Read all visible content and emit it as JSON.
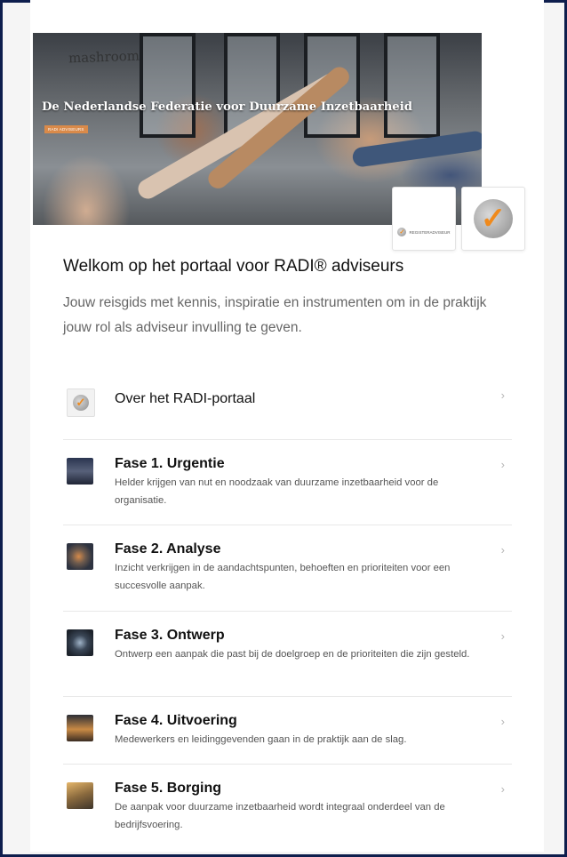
{
  "hero": {
    "title": "De Nederlandse Federatie voor Duurzame Inzetbaarheid",
    "tag": "RADI ADVISEURS",
    "brand": "mashroom"
  },
  "logos": {
    "register_label": "REGISTERADVISEUR"
  },
  "welcome": {
    "title": "Welkom op het portaal voor RADI® adviseurs",
    "intro": "Jouw reisgids met kennis, inspiratie en instrumenten om in de praktijk jouw rol als adviseur invulling te geven."
  },
  "items": [
    {
      "title": "Over het RADI-portaal",
      "desc": "",
      "icon": "radi-check-icon"
    },
    {
      "title": "Fase 1. Urgentie",
      "desc": "Helder krijgen van nut en noodzaak van duurzame inzetbaarheid voor de organisatie.",
      "icon": "urgency-thumbnail"
    },
    {
      "title": "Fase 2. Analyse",
      "desc": "Inzicht verkrijgen in de aandachtspunten, behoeften en prioriteiten voor een succesvolle aanpak.",
      "icon": "analysis-thumbnail"
    },
    {
      "title": "Fase 3. Ontwerp",
      "desc": "Ontwerp een aanpak die past bij de doelgroep en de prioriteiten die zijn gesteld.",
      "icon": "design-thumbnail"
    },
    {
      "title": "Fase 4. Uitvoering",
      "desc": "Medewerkers en leidinggevenden gaan in de praktijk aan de slag.",
      "icon": "execution-thumbnail"
    },
    {
      "title": "Fase 5. Borging",
      "desc": "De aanpak voor duurzame inzetbaarheid wordt integraal onderdeel van de bedrijfsvoering.",
      "icon": "assurance-thumbnail"
    }
  ],
  "colors": {
    "frame": "#0e1e4d",
    "accent": "#f08a1c",
    "tag": "#d98a4a"
  }
}
